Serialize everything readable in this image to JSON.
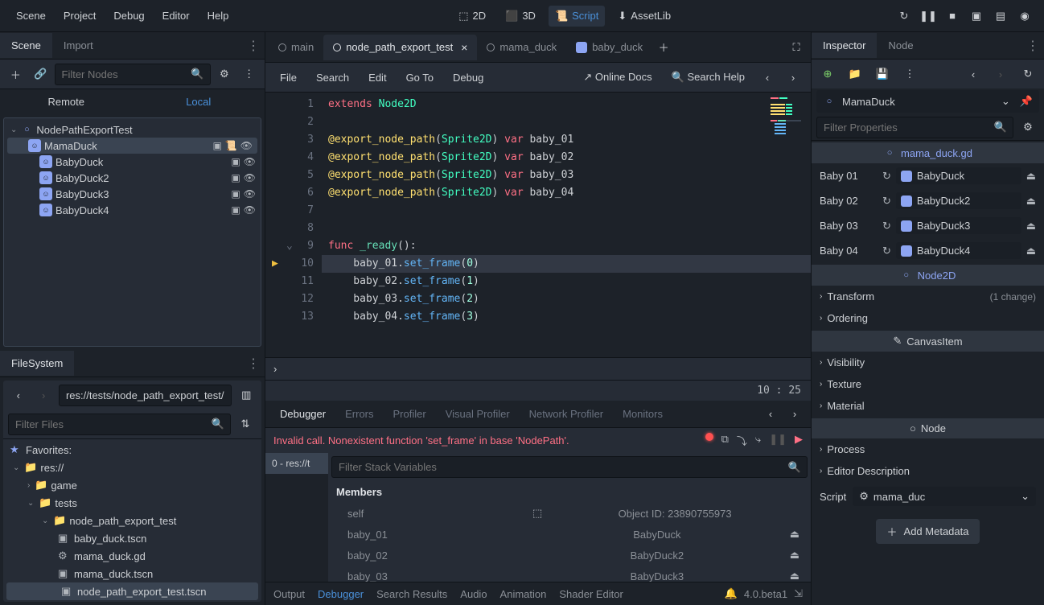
{
  "menubar": {
    "items": [
      "Scene",
      "Project",
      "Debug",
      "Editor",
      "Help"
    ],
    "modes": {
      "d2": "2D",
      "d3": "3D",
      "script": "Script",
      "assetlib": "AssetLib"
    }
  },
  "scene_panel": {
    "tabs": {
      "scene": "Scene",
      "import": "Import"
    },
    "filter_placeholder": "Filter Nodes",
    "remote": "Remote",
    "local": "Local",
    "tree": {
      "root": "NodePathExportTest",
      "nodes": [
        "MamaDuck",
        "BabyDuck",
        "BabyDuck2",
        "BabyDuck3",
        "BabyDuck4"
      ]
    }
  },
  "filesystem": {
    "tab": "FileSystem",
    "path": "res://tests/node_path_export_test/",
    "filter_placeholder": "Filter Files",
    "favorites": "Favorites:",
    "tree": {
      "root": "res://",
      "dirs": [
        "game",
        "tests"
      ],
      "subdir": "node_path_export_test",
      "files": [
        "baby_duck.tscn",
        "mama_duck.gd",
        "mama_duck.tscn",
        "node_path_export_test.tscn"
      ]
    }
  },
  "script_tabs": {
    "main": "main",
    "active": "node_path_export_test",
    "mama": "mama_duck",
    "baby": "baby_duck"
  },
  "editor_menu": {
    "items": [
      "File",
      "Search",
      "Edit",
      "Go To",
      "Debug"
    ],
    "online_docs": "Online Docs",
    "search_help": "Search Help"
  },
  "code": {
    "lines": [
      {
        "n": 1,
        "tokens": [
          {
            "t": "extends",
            "c": "kw-red"
          },
          {
            "t": " ",
            "c": "txt"
          },
          {
            "t": "Node2D",
            "c": "kw-cyan"
          }
        ]
      },
      {
        "n": 2,
        "tokens": []
      },
      {
        "n": 3,
        "tokens": [
          {
            "t": "@export_node_path",
            "c": "kw-yellow"
          },
          {
            "t": "(",
            "c": "txt"
          },
          {
            "t": "Sprite2D",
            "c": "kw-cyan"
          },
          {
            "t": ") ",
            "c": "txt"
          },
          {
            "t": "var",
            "c": "kw-red"
          },
          {
            "t": " baby_01",
            "c": "txt"
          }
        ]
      },
      {
        "n": 4,
        "tokens": [
          {
            "t": "@export_node_path",
            "c": "kw-yellow"
          },
          {
            "t": "(",
            "c": "txt"
          },
          {
            "t": "Sprite2D",
            "c": "kw-cyan"
          },
          {
            "t": ") ",
            "c": "txt"
          },
          {
            "t": "var",
            "c": "kw-red"
          },
          {
            "t": " baby_02",
            "c": "txt"
          }
        ]
      },
      {
        "n": 5,
        "tokens": [
          {
            "t": "@export_node_path",
            "c": "kw-yellow"
          },
          {
            "t": "(",
            "c": "txt"
          },
          {
            "t": "Sprite2D",
            "c": "kw-cyan"
          },
          {
            "t": ") ",
            "c": "txt"
          },
          {
            "t": "var",
            "c": "kw-red"
          },
          {
            "t": " baby_03",
            "c": "txt"
          }
        ]
      },
      {
        "n": 6,
        "tokens": [
          {
            "t": "@export_node_path",
            "c": "kw-yellow"
          },
          {
            "t": "(",
            "c": "txt"
          },
          {
            "t": "Sprite2D",
            "c": "kw-cyan"
          },
          {
            "t": ") ",
            "c": "txt"
          },
          {
            "t": "var",
            "c": "kw-red"
          },
          {
            "t": " baby_04",
            "c": "txt"
          }
        ]
      },
      {
        "n": 7,
        "tokens": []
      },
      {
        "n": 8,
        "tokens": []
      },
      {
        "n": 9,
        "tokens": [
          {
            "t": "func",
            "c": "kw-red"
          },
          {
            "t": " ",
            "c": "txt"
          },
          {
            "t": "_ready",
            "c": "kw-func"
          },
          {
            "t": "():",
            "c": "txt"
          }
        ],
        "fold": true
      },
      {
        "n": 10,
        "tokens": [
          {
            "t": "    baby_01.",
            "c": "txt"
          },
          {
            "t": "set_frame",
            "c": "kw-blue"
          },
          {
            "t": "(",
            "c": "txt"
          },
          {
            "t": "0",
            "c": "num"
          },
          {
            "t": ")",
            "c": "txt"
          }
        ],
        "bp": true,
        "hilite": true
      },
      {
        "n": 11,
        "tokens": [
          {
            "t": "    baby_02.",
            "c": "txt"
          },
          {
            "t": "set_frame",
            "c": "kw-blue"
          },
          {
            "t": "(",
            "c": "txt"
          },
          {
            "t": "1",
            "c": "num"
          },
          {
            "t": ")",
            "c": "txt"
          }
        ]
      },
      {
        "n": 12,
        "tokens": [
          {
            "t": "    baby_03.",
            "c": "txt"
          },
          {
            "t": "set_frame",
            "c": "kw-blue"
          },
          {
            "t": "(",
            "c": "txt"
          },
          {
            "t": "2",
            "c": "num"
          },
          {
            "t": ")",
            "c": "txt"
          }
        ]
      },
      {
        "n": 13,
        "tokens": [
          {
            "t": "    baby_04.",
            "c": "txt"
          },
          {
            "t": "set_frame",
            "c": "kw-blue"
          },
          {
            "t": "(",
            "c": "txt"
          },
          {
            "t": "3",
            "c": "num"
          },
          {
            "t": ")",
            "c": "txt"
          }
        ]
      }
    ],
    "status": "10 :  25"
  },
  "debugger": {
    "tabs": [
      "Debugger",
      "Errors",
      "Profiler",
      "Visual Profiler",
      "Network Profiler",
      "Monitors"
    ],
    "error": "Invalid call. Nonexistent function 'set_frame' in base 'NodePath'.",
    "stack_frame": "0 - res://t",
    "filter_stack": "Filter Stack Variables",
    "members_label": "Members",
    "members": [
      {
        "name": "self",
        "val": "Object ID: 23890755973",
        "obj": true
      },
      {
        "name": "baby_01",
        "val": "BabyDuck"
      },
      {
        "name": "baby_02",
        "val": "BabyDuck2"
      },
      {
        "name": "baby_03",
        "val": "BabyDuck3"
      }
    ]
  },
  "bottom": {
    "items": [
      "Output",
      "Debugger",
      "Search Results",
      "Audio",
      "Animation",
      "Shader Editor"
    ],
    "version": "4.0.beta1"
  },
  "inspector": {
    "tabs": {
      "inspector": "Inspector",
      "node": "Node"
    },
    "node_name": "MamaDuck",
    "filter_placeholder": "Filter Properties",
    "script_file": "mama_duck.gd",
    "sections": {
      "node2d": "Node2D",
      "canvas": "CanvasItem",
      "node": "Node"
    },
    "props": [
      {
        "label": "Baby 01",
        "val": "BabyDuck"
      },
      {
        "label": "Baby 02",
        "val": "BabyDuck2"
      },
      {
        "label": "Baby 03",
        "val": "BabyDuck3"
      },
      {
        "label": "Baby 04",
        "val": "BabyDuck4"
      }
    ],
    "groups": {
      "transform": {
        "label": "Transform",
        "info": "(1 change)"
      },
      "ordering": "Ordering",
      "visibility": "Visibility",
      "texture": "Texture",
      "material": "Material",
      "process": "Process",
      "editor_desc": "Editor Description"
    },
    "script_label": "Script",
    "script_val": "mama_duc",
    "add_meta": "Add Metadata"
  }
}
